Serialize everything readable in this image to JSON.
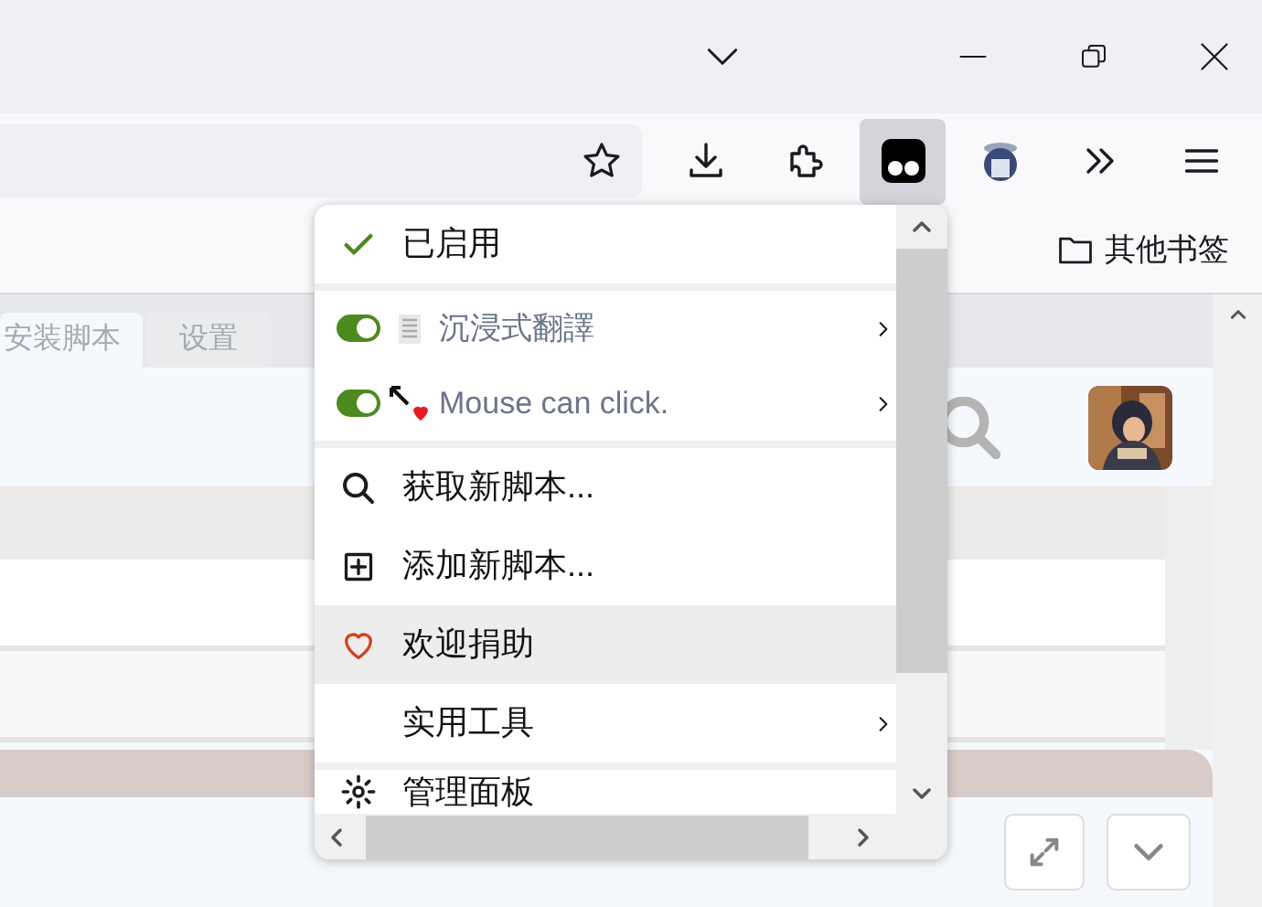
{
  "bookmarks": {
    "folder": "其他书签"
  },
  "page": {
    "tabs": [
      {
        "label": "安装脚本",
        "selected": true
      },
      {
        "label": "设置",
        "selected": false
      }
    ]
  },
  "menu": {
    "status": {
      "label": "已启用",
      "checked": true
    },
    "scripts": [
      {
        "name": "沉浸式翻譯",
        "on": true,
        "submenu": true
      },
      {
        "name": "Mouse can click.",
        "on": true,
        "submenu": true
      }
    ],
    "commands": [
      {
        "label": "获取新脚本...",
        "selected": false,
        "submenu": false
      },
      {
        "label": "添加新脚本...",
        "selected": false,
        "submenu": false
      },
      {
        "label": "欢迎捐助",
        "selected": true,
        "submenu": false
      },
      {
        "label": "实用工具",
        "selected": false,
        "submenu": true
      }
    ],
    "footer": [
      {
        "label": "管理面板"
      }
    ]
  }
}
